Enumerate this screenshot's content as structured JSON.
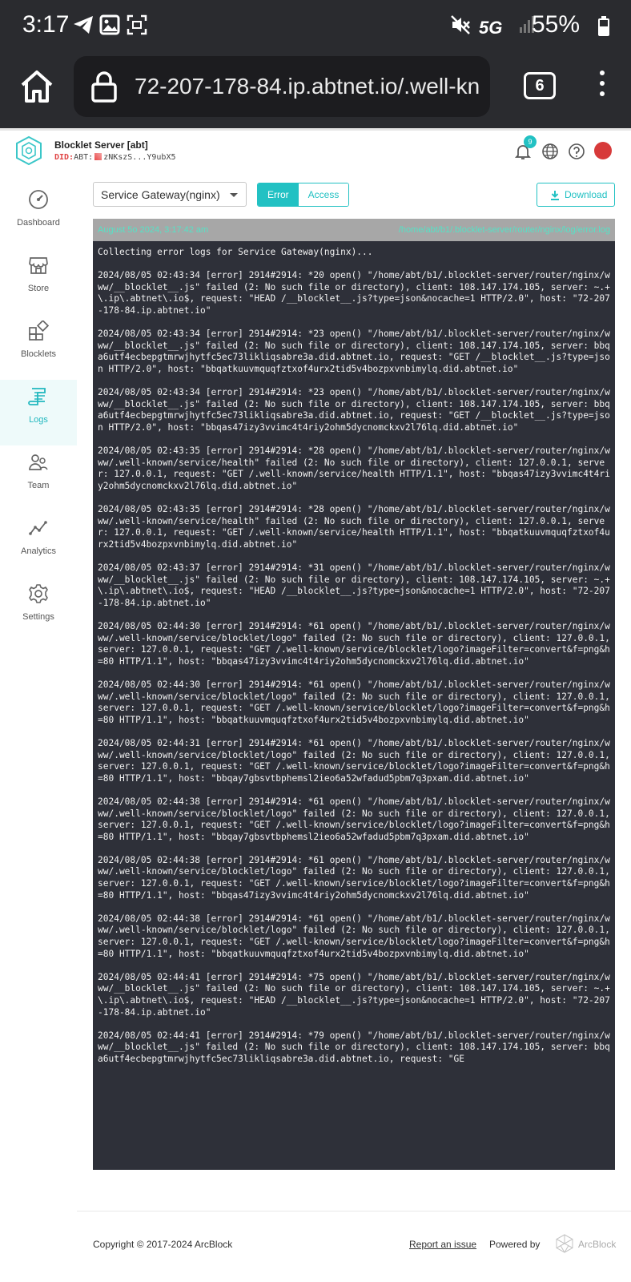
{
  "status_bar": {
    "time": "3:17",
    "network": "5G",
    "battery": "55%"
  },
  "browser": {
    "url": "72-207-178-84.ip.abtnet.io/.well-kn",
    "tab_count": "6"
  },
  "header": {
    "title": "Blocklet Server [abt]",
    "did_prefix": "DID:",
    "did_type": "ABT:",
    "did_value": "zNKszS...Y9ubX5",
    "notification_count": "9"
  },
  "sidebar": {
    "items": [
      {
        "label": "Dashboard",
        "icon": "dashboard-icon"
      },
      {
        "label": "Store",
        "icon": "store-icon"
      },
      {
        "label": "Blocklets",
        "icon": "blocklets-icon"
      },
      {
        "label": "Logs",
        "icon": "logs-icon",
        "active": true
      },
      {
        "label": "Team",
        "icon": "team-icon"
      },
      {
        "label": "Analytics",
        "icon": "analytics-icon"
      },
      {
        "label": "Settings",
        "icon": "settings-icon"
      }
    ]
  },
  "toolbar": {
    "gateway_select": "Service Gateway(nginx)",
    "error_label": "Error",
    "access_label": "Access",
    "download_label": "Download"
  },
  "log": {
    "date": "August 5o 2024, 3:17:42 am",
    "path": "/home/abt/b1/.blocklet-server/router/nginx/log/error.log",
    "intro": "Collecting error logs for Service Gateway(nginx)...",
    "entries": [
      "2024/08/05 02:43:34 [error] 2914#2914: *20 open() \"/home/abt/b1/.blocklet-server/router/nginx/www/__blocklet__.js\" failed (2: No such file or directory), client: 108.147.174.105, server: ~.+\\.ip\\.abtnet\\.io$, request: \"HEAD /__blocklet__.js?type=json&nocache=1 HTTP/2.0\", host: \"72-207-178-84.ip.abtnet.io\"",
      "2024/08/05 02:43:34 [error] 2914#2914: *23 open() \"/home/abt/b1/.blocklet-server/router/nginx/www/__blocklet__.js\" failed (2: No such file or directory), client: 108.147.174.105, server: bbqa6utf4ecbepgtmrwjhytfc5ec73likliqsabre3a.did.abtnet.io, request: \"GET /__blocklet__.js?type=json HTTP/2.0\", host: \"bbqatkuuvmquqfztxof4urx2tid5v4bozpxvnbimylq.did.abtnet.io\"",
      "2024/08/05 02:43:34 [error] 2914#2914: *23 open() \"/home/abt/b1/.blocklet-server/router/nginx/www/__blocklet__.js\" failed (2: No such file or directory), client: 108.147.174.105, server: bbqa6utf4ecbepgtmrwjhytfc5ec73likliqsabre3a.did.abtnet.io, request: \"GET /__blocklet__.js?type=json HTTP/2.0\", host: \"bbqas47izy3vvimc4t4riy2ohm5dycnomckxv2l76lq.did.abtnet.io\"",
      "2024/08/05 02:43:35 [error] 2914#2914: *28 open() \"/home/abt/b1/.blocklet-server/router/nginx/www/.well-known/service/health\" failed (2: No such file or directory), client: 127.0.0.1, server: 127.0.0.1, request: \"GET /.well-known/service/health HTTP/1.1\", host: \"bbqas47izy3vvimc4t4riy2ohm5dycnomckxv2l76lq.did.abtnet.io\"",
      "2024/08/05 02:43:35 [error] 2914#2914: *28 open() \"/home/abt/b1/.blocklet-server/router/nginx/www/.well-known/service/health\" failed (2: No such file or directory), client: 127.0.0.1, server: 127.0.0.1, request: \"GET /.well-known/service/health HTTP/1.1\", host: \"bbqatkuuvmquqfztxof4urx2tid5v4bozpxvnbimylq.did.abtnet.io\"",
      "2024/08/05 02:43:37 [error] 2914#2914: *31 open() \"/home/abt/b1/.blocklet-server/router/nginx/www/__blocklet__.js\" failed (2: No such file or directory), client: 108.147.174.105, server: ~.+\\.ip\\.abtnet\\.io$, request: \"HEAD /__blocklet__.js?type=json&nocache=1 HTTP/2.0\", host: \"72-207-178-84.ip.abtnet.io\"",
      "2024/08/05 02:44:30 [error] 2914#2914: *61 open() \"/home/abt/b1/.blocklet-server/router/nginx/www/.well-known/service/blocklet/logo\" failed (2: No such file or directory), client: 127.0.0.1, server: 127.0.0.1, request: \"GET /.well-known/service/blocklet/logo?imageFilter=convert&f=png&h=80 HTTP/1.1\", host: \"bbqas47izy3vvimc4t4riy2ohm5dycnomckxv2l76lq.did.abtnet.io\"",
      "2024/08/05 02:44:30 [error] 2914#2914: *61 open() \"/home/abt/b1/.blocklet-server/router/nginx/www/.well-known/service/blocklet/logo\" failed (2: No such file or directory), client: 127.0.0.1, server: 127.0.0.1, request: \"GET /.well-known/service/blocklet/logo?imageFilter=convert&f=png&h=80 HTTP/1.1\", host: \"bbqatkuuvmquqfztxof4urx2tid5v4bozpxvnbimylq.did.abtnet.io\"",
      "2024/08/05 02:44:31 [error] 2914#2914: *61 open() \"/home/abt/b1/.blocklet-server/router/nginx/www/.well-known/service/blocklet/logo\" failed (2: No such file or directory), client: 127.0.0.1, server: 127.0.0.1, request: \"GET /.well-known/service/blocklet/logo?imageFilter=convert&f=png&h=80 HTTP/1.1\", host: \"bbqay7gbsvtbphemsl2ieo6a52wfadud5pbm7q3pxam.did.abtnet.io\"",
      "2024/08/05 02:44:38 [error] 2914#2914: *61 open() \"/home/abt/b1/.blocklet-server/router/nginx/www/.well-known/service/blocklet/logo\" failed (2: No such file or directory), client: 127.0.0.1, server: 127.0.0.1, request: \"GET /.well-known/service/blocklet/logo?imageFilter=convert&f=png&h=80 HTTP/1.1\", host: \"bbqay7gbsvtbphemsl2ieo6a52wfadud5pbm7q3pxam.did.abtnet.io\"",
      "2024/08/05 02:44:38 [error] 2914#2914: *61 open() \"/home/abt/b1/.blocklet-server/router/nginx/www/.well-known/service/blocklet/logo\" failed (2: No such file or directory), client: 127.0.0.1, server: 127.0.0.1, request: \"GET /.well-known/service/blocklet/logo?imageFilter=convert&f=png&h=80 HTTP/1.1\", host: \"bbqas47izy3vvimc4t4riy2ohm5dycnomckxv2l76lq.did.abtnet.io\"",
      "2024/08/05 02:44:38 [error] 2914#2914: *61 open() \"/home/abt/b1/.blocklet-server/router/nginx/www/.well-known/service/blocklet/logo\" failed (2: No such file or directory), client: 127.0.0.1, server: 127.0.0.1, request: \"GET /.well-known/service/blocklet/logo?imageFilter=convert&f=png&h=80 HTTP/1.1\", host: \"bbqatkuuvmquqfztxof4urx2tid5v4bozpxvnbimylq.did.abtnet.io\"",
      "2024/08/05 02:44:41 [error] 2914#2914: *75 open() \"/home/abt/b1/.blocklet-server/router/nginx/www/__blocklet__.js\" failed (2: No such file or directory), client: 108.147.174.105, server: ~.+\\.ip\\.abtnet\\.io$, request: \"HEAD /__blocklet__.js?type=json&nocache=1 HTTP/2.0\", host: \"72-207-178-84.ip.abtnet.io\"",
      "2024/08/05 02:44:41 [error] 2914#2914: *79 open() \"/home/abt/b1/.blocklet-server/router/nginx/www/__blocklet__.js\" failed (2: No such file or directory), client: 108.147.174.105, server: bbqa6utf4ecbepgtmrwjhytfc5ec73likliqsabre3a.did.abtnet.io, request: \"GE"
    ]
  },
  "footer": {
    "copyright": "Copyright © 2017-2024  ArcBlock",
    "report": "Report an issue",
    "powered_by": "Powered by",
    "brand": "ArcBlock"
  }
}
